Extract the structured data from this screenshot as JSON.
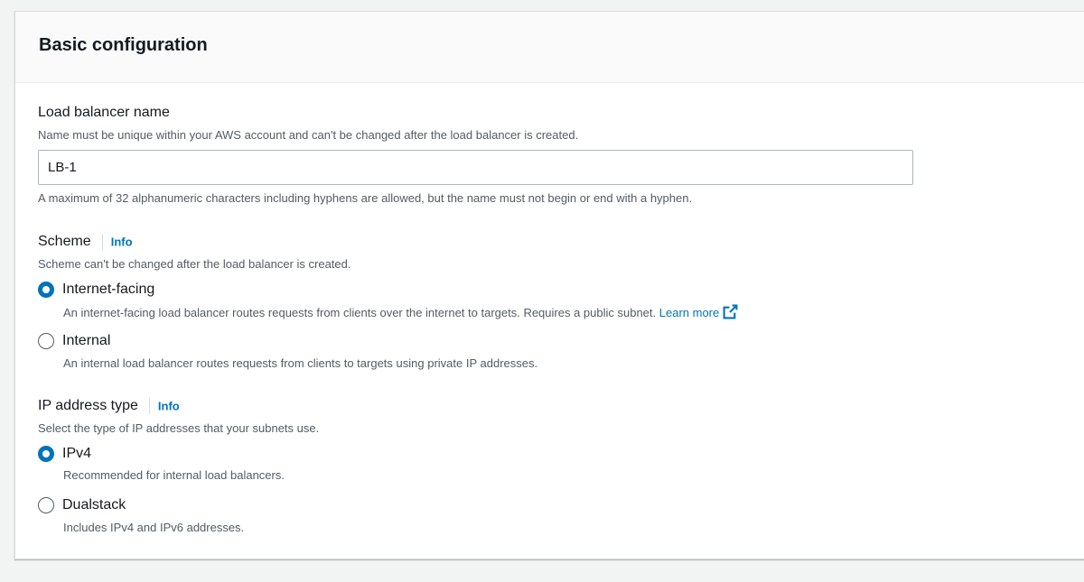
{
  "panel": {
    "title": "Basic configuration"
  },
  "name_field": {
    "label": "Load balancer name",
    "description": "Name must be unique within your AWS account and can't be changed after the load balancer is created.",
    "value": "LB-1",
    "constraint": "A maximum of 32 alphanumeric characters including hyphens are allowed, but the name must not begin or end with a hyphen."
  },
  "scheme": {
    "label": "Scheme",
    "info": "Info",
    "description": "Scheme can't be changed after the load balancer is created.",
    "options": [
      {
        "label": "Internet-facing",
        "description": "An internet-facing load balancer routes requests from clients over the internet to targets. Requires a public subnet.",
        "link": "Learn more",
        "selected": true
      },
      {
        "label": "Internal",
        "description": "An internal load balancer routes requests from clients to targets using private IP addresses.",
        "selected": false
      }
    ]
  },
  "ip_type": {
    "label": "IP address type",
    "info": "Info",
    "description": "Select the type of IP addresses that your subnets use.",
    "options": [
      {
        "label": "IPv4",
        "description": "Recommended for internal load balancers.",
        "selected": true
      },
      {
        "label": "Dualstack",
        "description": "Includes IPv4 and IPv6 addresses.",
        "selected": false
      }
    ]
  },
  "colors": {
    "accent": "#0073bb",
    "text": "#16191f",
    "secondary_text": "#545b64",
    "background": "#f2f3f3"
  },
  "icons": {
    "external_link": "external-link-icon"
  }
}
